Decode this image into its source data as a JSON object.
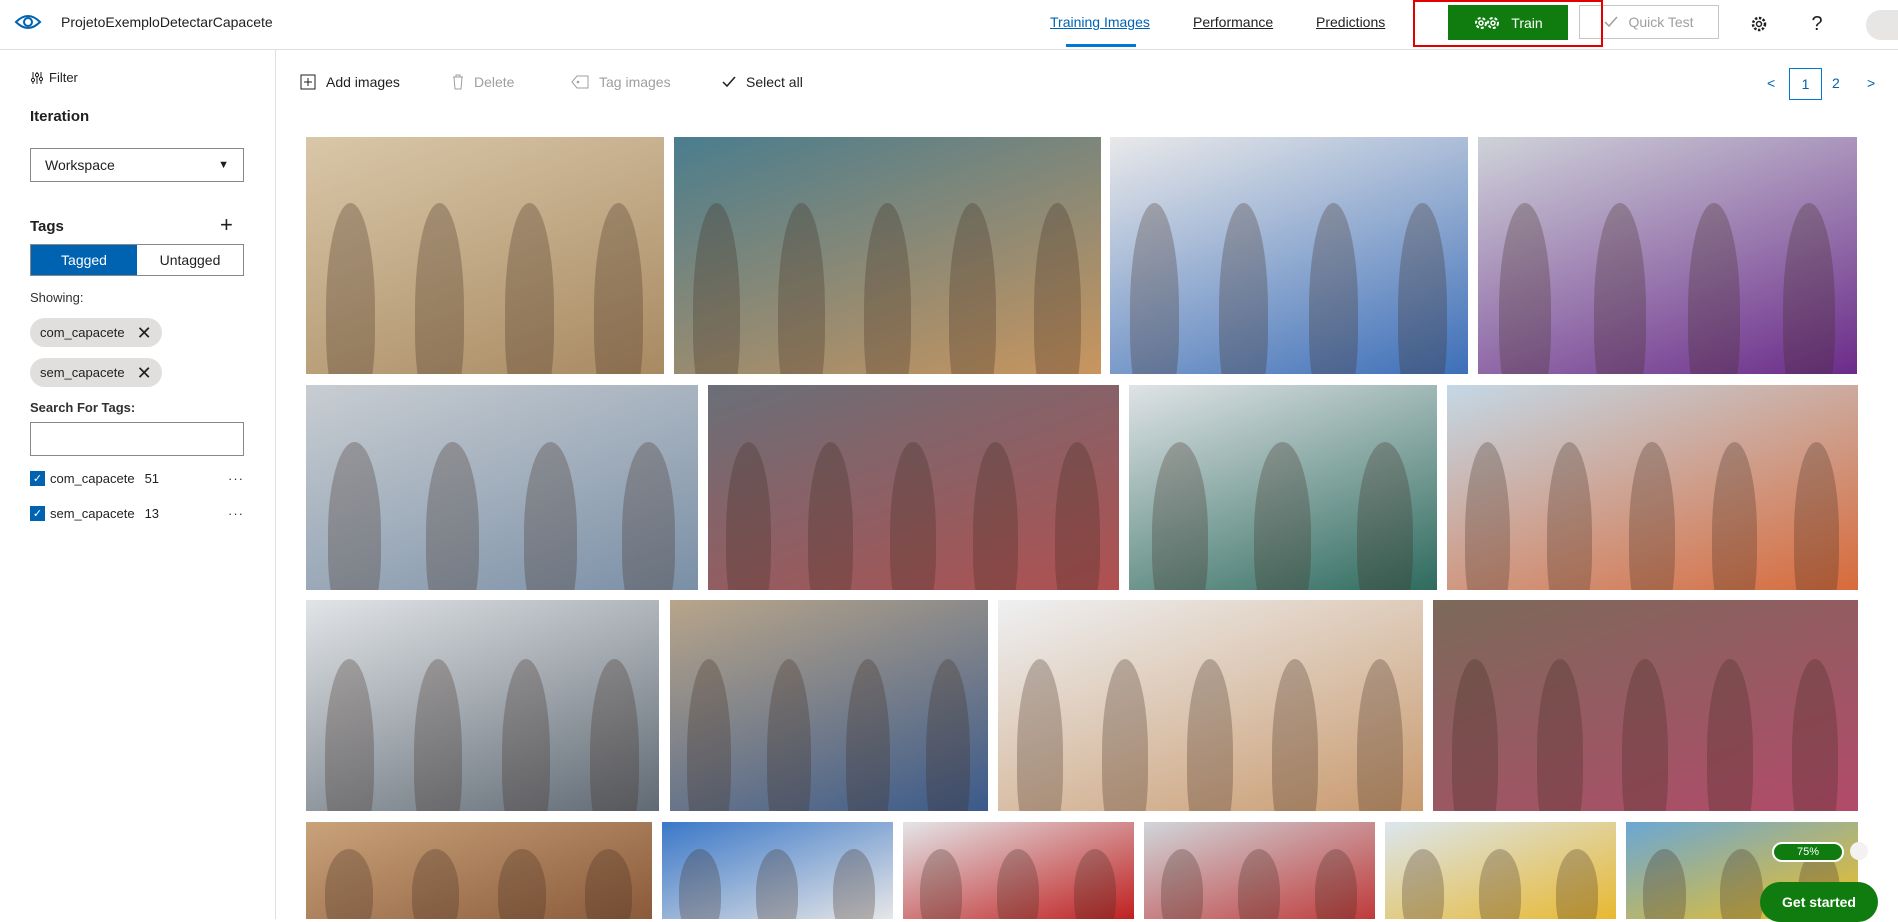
{
  "header": {
    "project_name": "ProjetoExemploDetectarCapacete",
    "nav": [
      {
        "label": "Training Images",
        "active": true
      },
      {
        "label": "Performance",
        "active": false
      },
      {
        "label": "Predictions",
        "active": false
      }
    ],
    "train_label": "Train",
    "quick_test_label": "Quick Test",
    "settings_icon": "gear-icon",
    "help_label": "?"
  },
  "sidebar": {
    "filter_label": "Filter",
    "iteration_label": "Iteration",
    "iteration_value": "Workspace",
    "tags_label": "Tags",
    "tagged_label": "Tagged",
    "untagged_label": "Untagged",
    "showing_label": "Showing:",
    "chips": [
      "com_capacete",
      "sem_capacete"
    ],
    "search_label": "Search For Tags:",
    "search_value": "",
    "tags": [
      {
        "name": "com_capacete",
        "count": "51",
        "checked": true
      },
      {
        "name": "sem_capacete",
        "count": "13",
        "checked": true
      }
    ]
  },
  "toolbar": {
    "add_images": "Add images",
    "delete": "Delete",
    "tag_images": "Tag images",
    "select_all": "Select all"
  },
  "pagination": {
    "prev": "<",
    "pages": [
      "1",
      "2"
    ],
    "current": "1",
    "next": ">"
  },
  "progress": {
    "label": "75%",
    "value": 0.75
  },
  "get_started_label": "Get started",
  "colors": {
    "accent": "#0063b1",
    "train_green": "#107c10",
    "highlight_red": "#e00000"
  }
}
